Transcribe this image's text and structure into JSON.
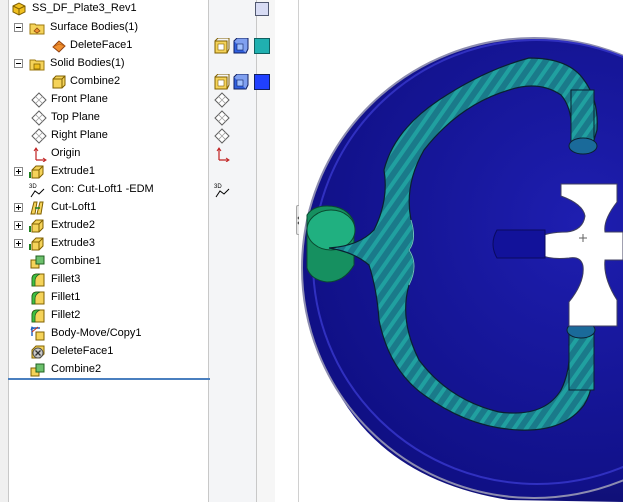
{
  "tree": {
    "root_label": "SS_DF_Plate3_Rev1",
    "items": [
      {
        "label": "Surface Bodies(1)",
        "icon": "surface-bodies-folder-icon"
      },
      {
        "label": "DeleteFace1",
        "icon": "surface-body-icon"
      },
      {
        "label": "Solid Bodies(1)",
        "icon": "solid-bodies-folder-icon"
      },
      {
        "label": "Combine2",
        "icon": "solid-body-icon"
      },
      {
        "label": "Front Plane",
        "icon": "plane-icon"
      },
      {
        "label": "Top Plane",
        "icon": "plane-icon"
      },
      {
        "label": "Right Plane",
        "icon": "plane-icon"
      },
      {
        "label": "Origin",
        "icon": "origin-icon"
      },
      {
        "label": "Extrude1",
        "icon": "extrude-icon"
      },
      {
        "label": "Con: Cut-Loft1 -EDM",
        "icon": "3d-sketch-icon"
      },
      {
        "label": "Cut-Loft1",
        "icon": "cut-loft-icon"
      },
      {
        "label": "Extrude2",
        "icon": "extrude-icon"
      },
      {
        "label": "Extrude3",
        "icon": "extrude-icon"
      },
      {
        "label": "Combine1",
        "icon": "combine-icon"
      },
      {
        "label": "Fillet3",
        "icon": "fillet-icon"
      },
      {
        "label": "Fillet1",
        "icon": "fillet-icon"
      },
      {
        "label": "Fillet2",
        "icon": "fillet-icon"
      },
      {
        "label": "Body-Move/Copy1",
        "icon": "body-move-copy-icon"
      },
      {
        "label": "DeleteFace1",
        "icon": "delete-face-icon"
      },
      {
        "label": "Combine2",
        "icon": "combine-icon"
      }
    ]
  },
  "colors": {
    "body_blue": "#1a1aa0",
    "rim_blue": "#2828b8",
    "teal_surface": "#20b0b0",
    "bright_blue": "#2040ff",
    "accent_line": "#4a7fbf"
  }
}
